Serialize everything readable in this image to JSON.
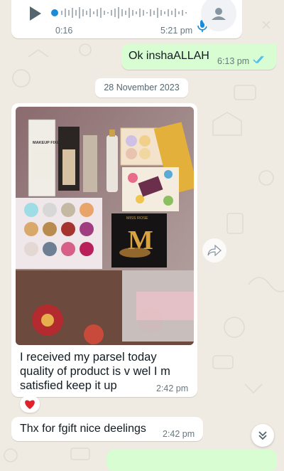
{
  "voice_message": {
    "duration": "0:16",
    "time": "5:21 pm",
    "icons": {
      "play": "play-icon",
      "mic": "mic-icon",
      "avatar": "person-icon"
    }
  },
  "outgoing_message": {
    "text": "Ok inshaALLAH",
    "time": "6:13 pm",
    "status": "read",
    "tick_color": "#53bdeb"
  },
  "date_chip": "28 November 2023",
  "image_message": {
    "caption": "I received my parsel today quality of product is v wel I m satisfied keep it up",
    "time": "2:42 pm",
    "photo_labels": {
      "makeup_fixer": "MAKEUP FIXER",
      "brand": "MISS ROSE",
      "brand_short": "M"
    },
    "reaction": "❤️"
  },
  "incoming_message_2": {
    "text": "Thx for fgift nice deelings",
    "time": "2:42 pm"
  },
  "buttons": {
    "forward": "forward-icon",
    "scroll_down": "double-chevron-down-icon"
  },
  "colors": {
    "background": "#efeae2",
    "incoming": "#ffffff",
    "outgoing": "#d9fdd3",
    "meta_text": "#667781",
    "mic_accent": "#1a8bd6",
    "reaction": "#e0202a"
  }
}
